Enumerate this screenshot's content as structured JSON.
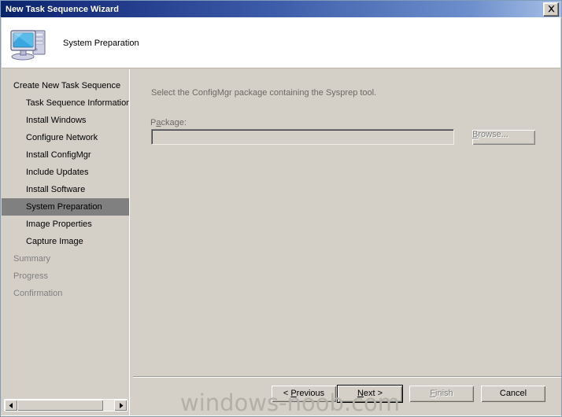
{
  "window": {
    "title": "New Task Sequence Wizard",
    "close_icon": "close-icon"
  },
  "header": {
    "icon": "computer-icon",
    "title": "System Preparation"
  },
  "sidebar": {
    "items": [
      {
        "label": "Create New Task Sequence",
        "level": 0,
        "state": "normal"
      },
      {
        "label": "Task Sequence Information",
        "level": 1,
        "state": "normal"
      },
      {
        "label": "Install Windows",
        "level": 1,
        "state": "normal"
      },
      {
        "label": "Configure Network",
        "level": 1,
        "state": "normal"
      },
      {
        "label": "Install ConfigMgr",
        "level": 1,
        "state": "normal"
      },
      {
        "label": "Include Updates",
        "level": 1,
        "state": "normal"
      },
      {
        "label": "Install Software",
        "level": 1,
        "state": "normal"
      },
      {
        "label": "System Preparation",
        "level": 1,
        "state": "selected"
      },
      {
        "label": "Image Properties",
        "level": 1,
        "state": "normal"
      },
      {
        "label": "Capture Image",
        "level": 1,
        "state": "normal"
      },
      {
        "label": "Summary",
        "level": 0,
        "state": "disabled"
      },
      {
        "label": "Progress",
        "level": 0,
        "state": "disabled"
      },
      {
        "label": "Confirmation",
        "level": 0,
        "state": "disabled"
      }
    ],
    "scrollbar": {
      "left_arrow": "◀",
      "right_arrow": "▶"
    }
  },
  "content": {
    "description": "Select the ConfigMgr package containing the Sysprep tool.",
    "package_label_pre": "P",
    "package_label_accel": "a",
    "package_label_post": "ckage:",
    "package_value": "",
    "package_placeholder": "",
    "browse_accel": "B",
    "browse_post": "rowse..."
  },
  "footer": {
    "previous_pre": "< ",
    "previous_accel": "P",
    "previous_post": "revious",
    "next_pre": "",
    "next_accel": "N",
    "next_post": "ext >",
    "finish_pre": "",
    "finish_accel": "F",
    "finish_post": "inish",
    "cancel_label": "Cancel"
  },
  "watermark": {
    "text": "windows-noob.com"
  },
  "colors": {
    "title_bar_start": "#0a246a",
    "title_bar_end": "#a6c0e6",
    "dialog_face": "#d4d0c8",
    "selection": "#808080",
    "disabled_text": "#808080",
    "watermark": "#b3b0a8"
  }
}
